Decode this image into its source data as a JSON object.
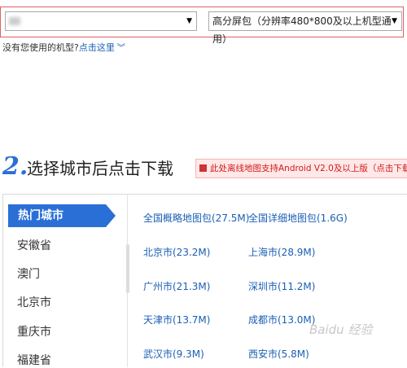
{
  "model_select": {
    "value": "",
    "arrow": "▼"
  },
  "screen_select": {
    "value": "高分屏包（分辨率480*800及以上机型通用）",
    "arrow": "▼"
  },
  "no_model": {
    "text": "没有您使用的机型?",
    "link": "点击这里",
    "chevron": "︾"
  },
  "step": {
    "number": "2.",
    "title": "选择城市后点击下载"
  },
  "notice": {
    "text": "此处离线地图支持Android V2.0及以上版（点击下载"
  },
  "sidebar": {
    "active": "热门城市",
    "items": [
      "安徽省",
      "澳门",
      "北京市",
      "重庆市",
      "福建省"
    ]
  },
  "downloads": [
    [
      "全国概略地图包(27.5M)",
      "全国详细地图包(1.6G)"
    ],
    [
      "北京市(23.2M)",
      "上海市(28.9M)"
    ],
    [
      "广州市(21.3M)",
      "深圳市(11.2M)"
    ],
    [
      "天津市(13.7M)",
      "成都市(13.0M)"
    ],
    [
      "武汉市(9.3M)",
      "西安市(5.8M)"
    ]
  ],
  "watermark": "Baidu 经验"
}
